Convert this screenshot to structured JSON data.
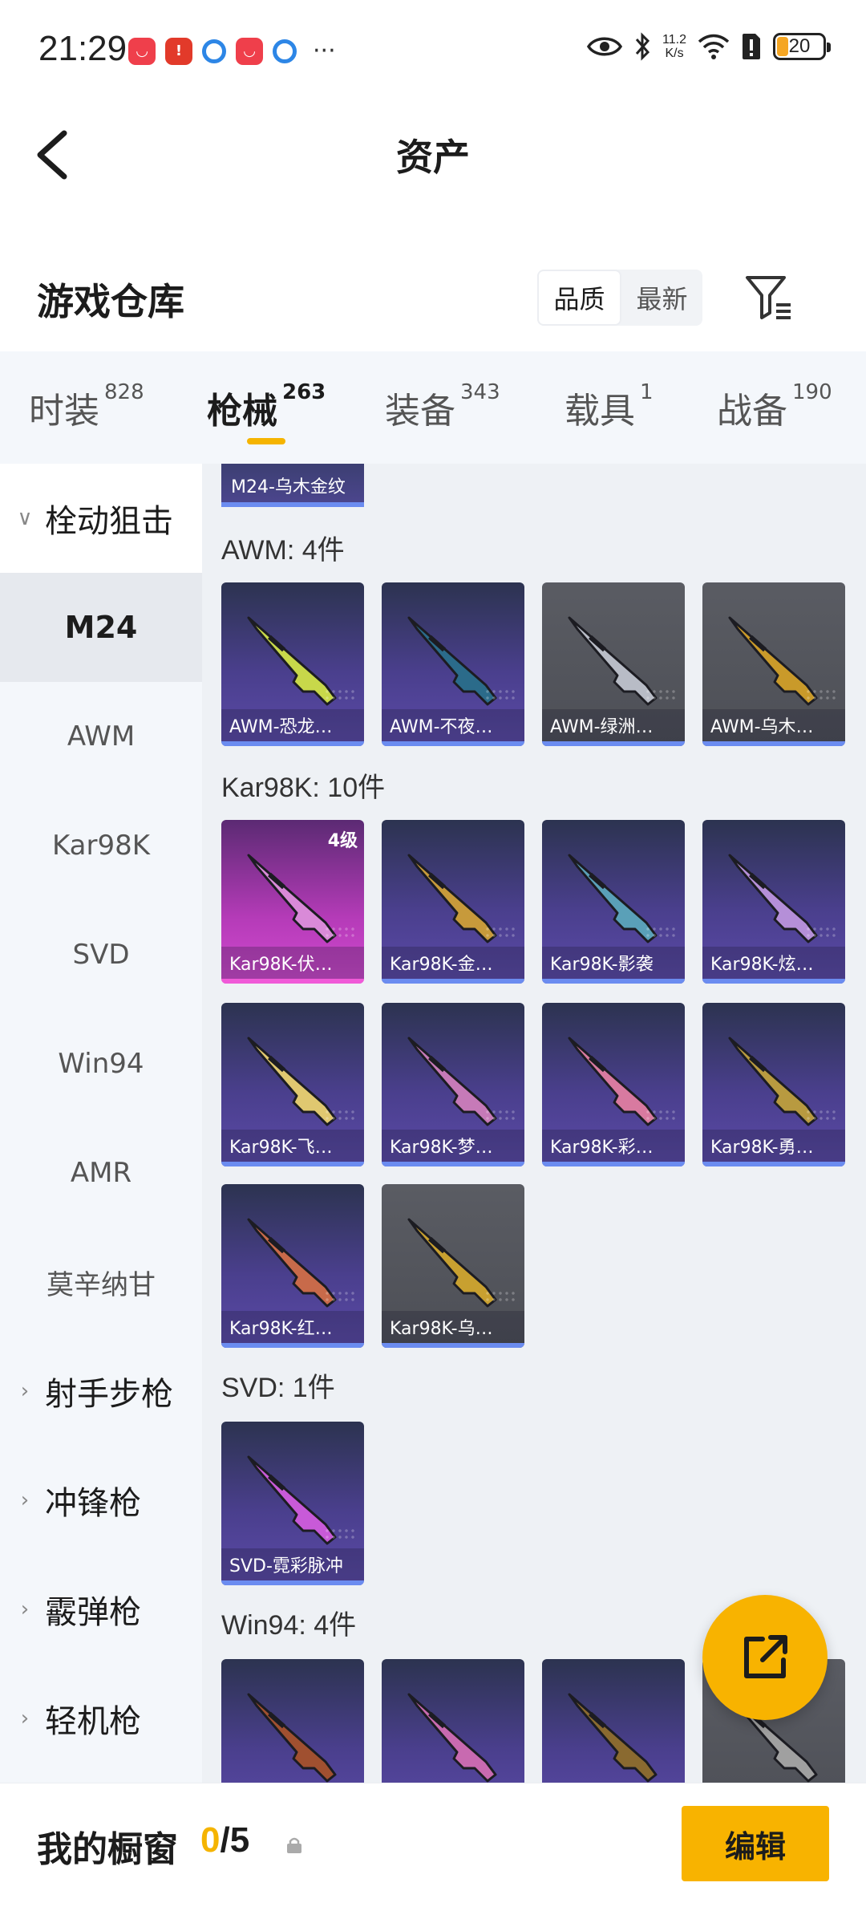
{
  "status_bar": {
    "time": "21:29",
    "network_speed_value": "11.2",
    "network_speed_unit": "K/s",
    "battery": "20",
    "app_icons": [
      "shopping-app-icon",
      "alert-app-icon",
      "browser-app-icon",
      "shopping-app-icon",
      "browser-app-icon"
    ],
    "more": "···"
  },
  "header": {
    "title": "资产"
  },
  "warehouse": {
    "title": "游戏仓库",
    "sort_options": [
      "品质",
      "最新"
    ],
    "active_sort": "品质"
  },
  "tabs": [
    {
      "label": "时装",
      "count": "828"
    },
    {
      "label": "枪械",
      "count": "263",
      "active": true
    },
    {
      "label": "装备",
      "count": "343"
    },
    {
      "label": "载具",
      "count": "1"
    },
    {
      "label": "战备",
      "count": "190"
    }
  ],
  "sidebar": {
    "group_open": "栓动狙击",
    "items": [
      "M24",
      "AWM",
      "Kar98K",
      "SVD",
      "Win94",
      "AMR",
      "莫辛纳甘"
    ],
    "active_item": "M24",
    "groups_closed": [
      "射手步枪",
      "冲锋枪",
      "霰弹枪",
      "轻机枪"
    ]
  },
  "content": {
    "top_chip": "M24-乌木金纹",
    "sections": [
      {
        "title": "AWM: 4件",
        "items": [
          "AWM-恐龙…",
          "AWM-不夜…",
          "AWM-绿洲…",
          "AWM-乌木…"
        ]
      },
      {
        "title": "Kar98K: 10件",
        "items": [
          "Kar98K-伏…",
          "Kar98K-金…",
          "Kar98K-影袭",
          "Kar98K-炫…",
          "Kar98K-飞…",
          "Kar98K-梦…",
          "Kar98K-彩…",
          "Kar98K-勇…",
          "Kar98K-红…",
          "Kar98K-乌…"
        ],
        "level_badge": "4级"
      },
      {
        "title": "SVD: 1件",
        "items": [
          "SVD-霓彩脉冲"
        ]
      },
      {
        "title": "Win94: 4件"
      }
    ]
  },
  "bottom_bar": {
    "title": "我的橱窗",
    "count_current": "0",
    "count_total": "/5",
    "edit_label": "编辑"
  },
  "colors": {
    "accent": "#f8b300",
    "card_purple": "#4a3f8d",
    "card_grey": "#5a5c63",
    "card_pink": "#d24ad0"
  }
}
